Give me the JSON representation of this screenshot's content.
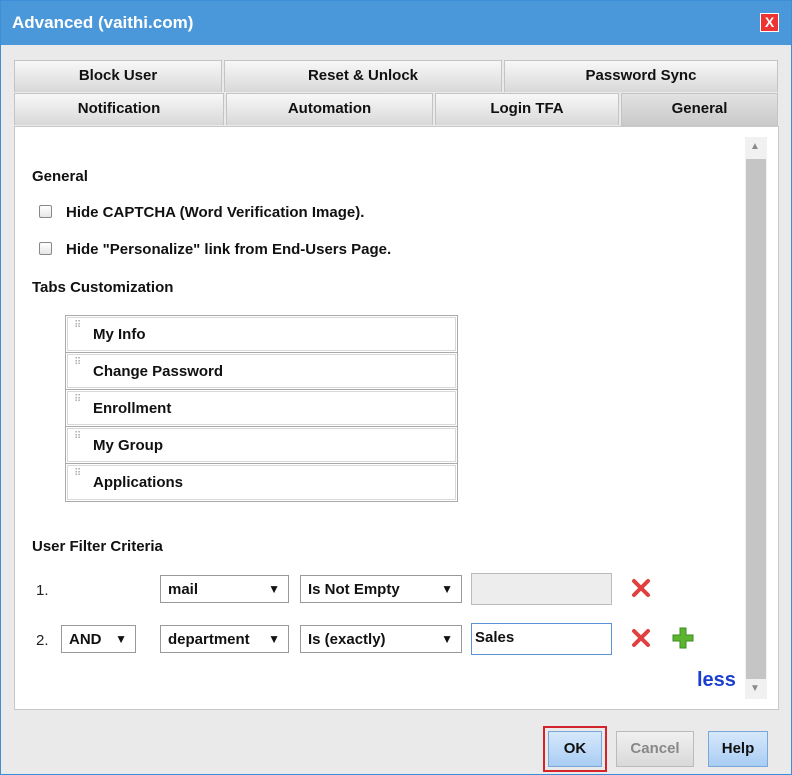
{
  "dialog": {
    "title": "Advanced (vaithi.com)",
    "close_label": "X"
  },
  "tabs_row1": [
    "Block User",
    "Reset & Unlock",
    "Password Sync"
  ],
  "tabs_row2": [
    "Notification",
    "Automation",
    "Login TFA",
    "General"
  ],
  "active_tab": "General",
  "general": {
    "section_title": "General",
    "options": [
      {
        "label": "Hide CAPTCHA (Word Verification Image).",
        "checked": false
      },
      {
        "label": "Hide \"Personalize\" link from End-Users Page.",
        "checked": false
      }
    ]
  },
  "tabs_customization": {
    "title": "Tabs Customization",
    "items": [
      "My Info",
      "Change Password",
      "Enrollment",
      "My Group",
      "Applications"
    ]
  },
  "filter": {
    "title": "User Filter Criteria",
    "rows": [
      {
        "num": "1.",
        "connector": "",
        "attribute": "mail",
        "condition": "Is Not Empty",
        "value": ""
      },
      {
        "num": "2.",
        "connector": "AND",
        "attribute": "department",
        "condition": "Is (exactly)",
        "value": "Sales"
      }
    ],
    "less_label": "less"
  },
  "footer": {
    "ok": "OK",
    "cancel": "Cancel",
    "help": "Help"
  },
  "colors": {
    "titlebar": "#4a97d9",
    "delete": "#e04040",
    "add": "#5cb531",
    "link": "#1a3fcf",
    "highlight": "#d3242c"
  }
}
